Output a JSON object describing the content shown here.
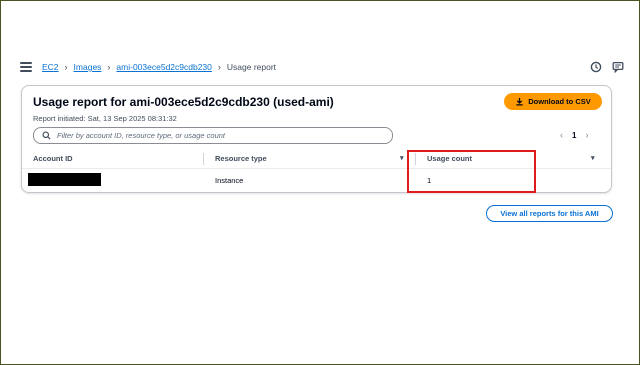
{
  "breadcrumb": {
    "items": [
      "EC2",
      "Images",
      "ami-003ece5d2c9cdb230"
    ],
    "current": "Usage report"
  },
  "panel": {
    "title": "Usage report for ami-003ece5d2c9cdb230 (used-ami)",
    "subtitle": "Report initiated: Sat, 13 Sep 2025 08:31:32",
    "download_label": "Download to CSV"
  },
  "search": {
    "placeholder": "Filter by account ID, resource type, or usage count"
  },
  "pagination": {
    "current_page": "1",
    "prev": "‹",
    "next": "›"
  },
  "table": {
    "columns": [
      "Account ID",
      "Resource type",
      "Usage count"
    ],
    "rows": [
      {
        "account_id": "",
        "resource_type": "Instance",
        "usage_count": "1"
      }
    ]
  },
  "footer": {
    "view_all_label": "View all reports for this AMI"
  },
  "colors": {
    "primary_button": "#ff9900",
    "link": "#0972d3",
    "highlight_box": "#e01b1b"
  },
  "icons": [
    "menu-icon",
    "chevron-right-icon",
    "clock-icon",
    "feedback-icon",
    "download-icon",
    "search-icon",
    "sort-icon"
  ]
}
